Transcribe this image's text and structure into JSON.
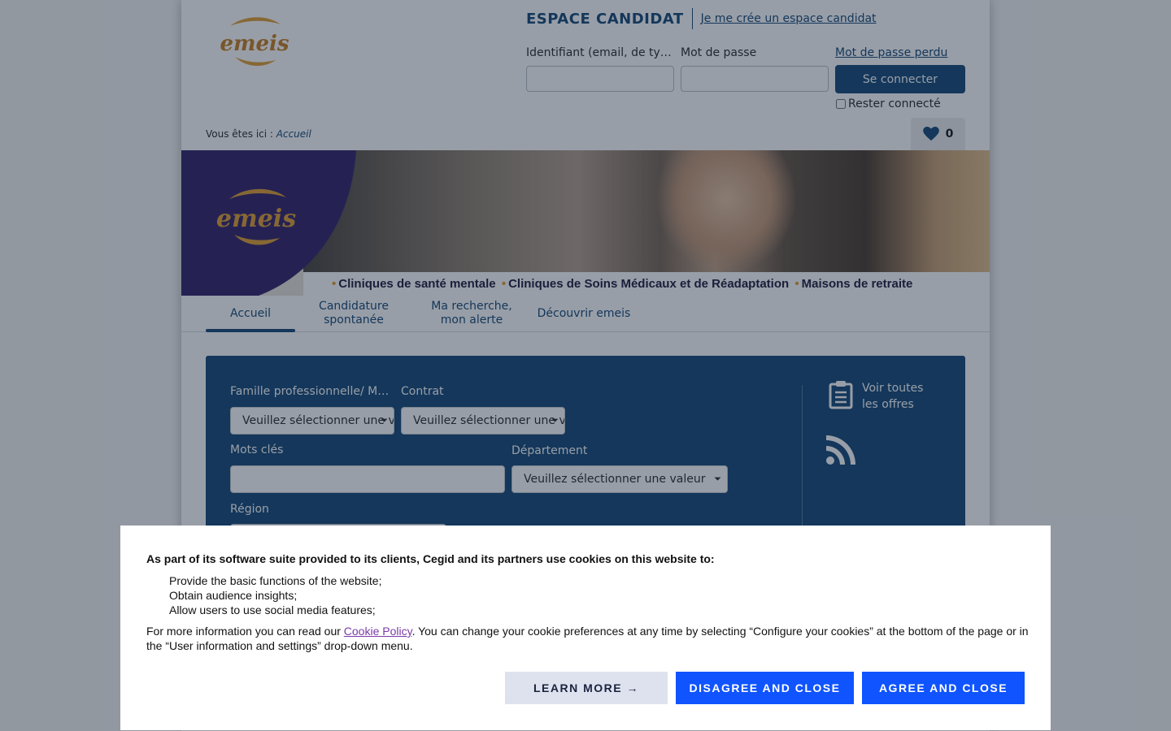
{
  "header": {
    "brand": "emeis",
    "espace_title": "ESPACE CANDIDAT",
    "create_link": "Je me crée un espace candidat",
    "login_label": "Identifiant (email, de ty…",
    "password_label": "Mot de passe",
    "lost_password": "Mot de passe perdu",
    "connect_button": "Se connecter",
    "remember_label": "Rester connecté",
    "favorites_count": "0"
  },
  "breadcrumb": {
    "prefix": "Vous êtes ici : ",
    "current": "Accueil"
  },
  "banner": {
    "brand": "emeis",
    "items": [
      "Cliniques de santé mentale",
      "Cliniques de Soins Médicaux et de Réadaptation",
      "Maisons de retraite"
    ]
  },
  "nav": {
    "tabs": [
      {
        "label": "Accueil",
        "active": true
      },
      {
        "label": "Candidature spontanée"
      },
      {
        "label": "Ma recherche, mon alerte"
      },
      {
        "label": "Découvrir emeis"
      }
    ]
  },
  "search": {
    "famille_label": "Famille professionnelle/ M…",
    "famille_value": "Veuillez sélectionner une valeur",
    "contrat_label": "Contrat",
    "contrat_value": "Veuillez sélectionner une valeur",
    "mots_cles_label": "Mots clés",
    "departement_label": "Département",
    "departement_value": "Veuillez sélectionner une valeur",
    "region_label": "Région",
    "all_jobs": "Voir toutes les offres"
  },
  "cookie": {
    "heading": "As part of its software suite provided to its clients, Cegid and its partners use cookies on this website to:",
    "items": [
      "Provide the basic functions of the website;",
      "Obtain audience insights;",
      "Allow users to use social media features;"
    ],
    "more_prefix": "For more information you can read our ",
    "policy_link": "Cookie Policy",
    "more_suffix": ". You can change your cookie preferences at any time by selecting “Configure your cookies” at the bottom of the page or in the “User information and settings” drop-down menu.",
    "learn_more": "LEARN MORE →",
    "disagree": "DISAGREE AND CLOSE",
    "agree": "AGREE AND CLOSE"
  },
  "colors": {
    "primary": "#1d4f7c",
    "brand_purple": "#3a2a6e",
    "brand_gold": "#e2a23a",
    "cookie_button": "#1054ff"
  }
}
